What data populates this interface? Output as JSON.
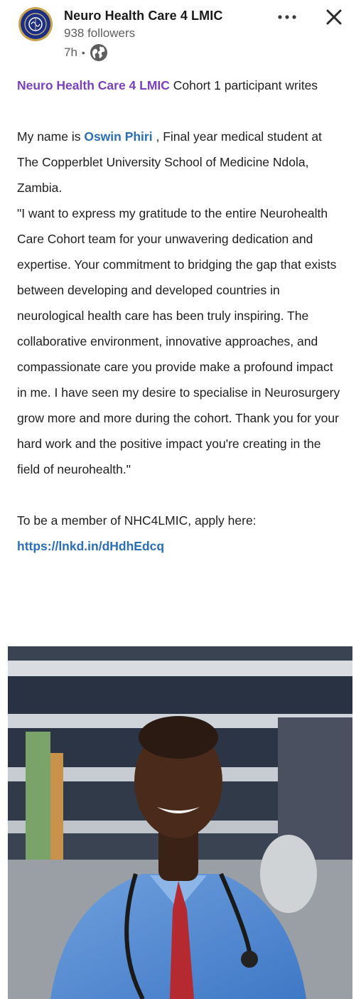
{
  "header": {
    "org_name": "Neuro Health Care 4 LMIC",
    "followers": "938 followers",
    "time": "7h",
    "separator": "•",
    "visibility_icon": "globe-icon",
    "more_icon": "more-horizontal-icon",
    "close_icon": "close-icon"
  },
  "post": {
    "line1": {
      "org_mention": "Neuro Health Care 4 LMIC",
      "text": " Cohort 1 participant writes"
    },
    "line2": {
      "prefix": "My name is ",
      "person_mention": "Oswin Phiri",
      "text": " , Final year medical student at The Copperblet University School of Medicine Ndola, Zambia."
    },
    "quote": "\"I want to express my gratitude to the entire Neurohealth Care Cohort team for your unwavering dedication and expertise. Your commitment to bridging the gap that exists between developing and developed countries in neurological health care has been truly inspiring. The collaborative environment, innovative approaches, and compassionate care you provide make a profound impact in me. I have seen my desire to specialise in Neurosurgery grow more and more during the cohort. Thank you for your hard work and the positive impact you're creating in the field of neurohealth.\"",
    "cta": "To be a member of NHC4LMIC, apply here:",
    "link": "https://lnkd.in/dHdhEdcq"
  },
  "photo": {
    "subject": "portrait-photo"
  },
  "colors": {
    "org_mention": "#7b3fbf",
    "person_mention": "#2a6fb8",
    "link": "#2a6fb8",
    "muted": "#5e5e5e"
  }
}
